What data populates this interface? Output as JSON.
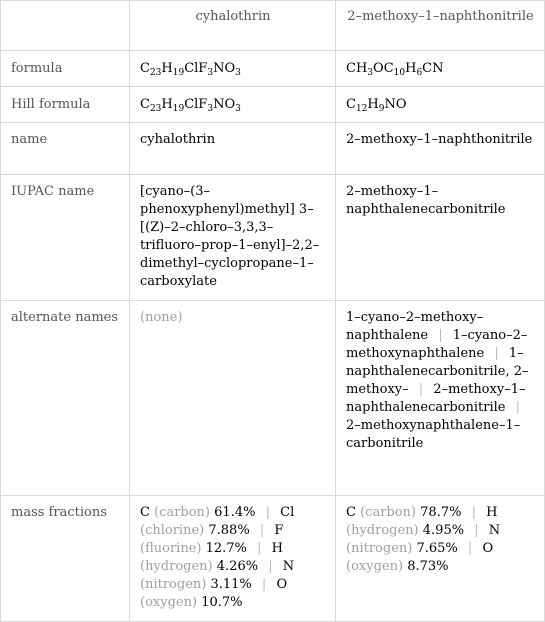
{
  "columns": [
    "",
    "cyhalothrin",
    "2–methoxy–1–naphthonitrile"
  ],
  "rows": {
    "formula": {
      "label": "formula",
      "col1": [
        {
          "t": "C"
        },
        {
          "s": "23"
        },
        {
          "t": "H"
        },
        {
          "s": "19"
        },
        {
          "t": "ClF"
        },
        {
          "s": "3"
        },
        {
          "t": "NO"
        },
        {
          "s": "3"
        }
      ],
      "col2": [
        {
          "t": "CH"
        },
        {
          "s": "3"
        },
        {
          "t": "OC"
        },
        {
          "s": "10"
        },
        {
          "t": "H"
        },
        {
          "s": "6"
        },
        {
          "t": "CN"
        }
      ]
    },
    "hill_formula": {
      "label": "Hill formula",
      "col1": [
        {
          "t": "C"
        },
        {
          "s": "23"
        },
        {
          "t": "H"
        },
        {
          "s": "19"
        },
        {
          "t": "ClF"
        },
        {
          "s": "3"
        },
        {
          "t": "NO"
        },
        {
          "s": "3"
        }
      ],
      "col2": [
        {
          "t": "C"
        },
        {
          "s": "12"
        },
        {
          "t": "H"
        },
        {
          "s": "9"
        },
        {
          "t": "NO"
        }
      ]
    },
    "name": {
      "label": "name",
      "col1": "cyhalothrin",
      "col2": "2–methoxy–1–naphthonitrile"
    },
    "iupac_name": {
      "label": "IUPAC name",
      "col1": "[cyano–(3–phenoxyphenyl)methyl] 3–[(Z)–2–chloro–3,3,3–trifluoro–prop–1–enyl]–2,2–dimethyl–cyclopropane–1–carboxylate",
      "col2": "2–methoxy–1–naphthalenecarbonitrile"
    },
    "alternate_names": {
      "label": "alternate names",
      "col1_none": "(none)",
      "col2": [
        "1–cyano–2–methoxy–naphthalene",
        "1–cyano–2–methoxynaphthalene",
        "1–naphthalenecarbonitrile, 2–methoxy–",
        "2–methoxy–1–naphthalenecarbonitrile",
        "2–methoxynaphthalene–1–carbonitrile"
      ]
    },
    "mass_fractions": {
      "label": "mass fractions",
      "col1": [
        {
          "symbol": "C",
          "name": "(carbon)",
          "value": "61.4%"
        },
        {
          "symbol": "Cl",
          "name": "(chlorine)",
          "value": "7.88%"
        },
        {
          "symbol": "F",
          "name": "(fluorine)",
          "value": "12.7%"
        },
        {
          "symbol": "H",
          "name": "(hydrogen)",
          "value": "4.26%"
        },
        {
          "symbol": "N",
          "name": "(nitrogen)",
          "value": "3.11%"
        },
        {
          "symbol": "O",
          "name": "(oxygen)",
          "value": "10.7%"
        }
      ],
      "col2": [
        {
          "symbol": "C",
          "name": "(carbon)",
          "value": "78.7%"
        },
        {
          "symbol": "H",
          "name": "(hydrogen)",
          "value": "4.95%"
        },
        {
          "symbol": "N",
          "name": "(nitrogen)",
          "value": "7.65%"
        },
        {
          "symbol": "O",
          "name": "(oxygen)",
          "value": "8.73%"
        }
      ]
    }
  },
  "separator": "|"
}
